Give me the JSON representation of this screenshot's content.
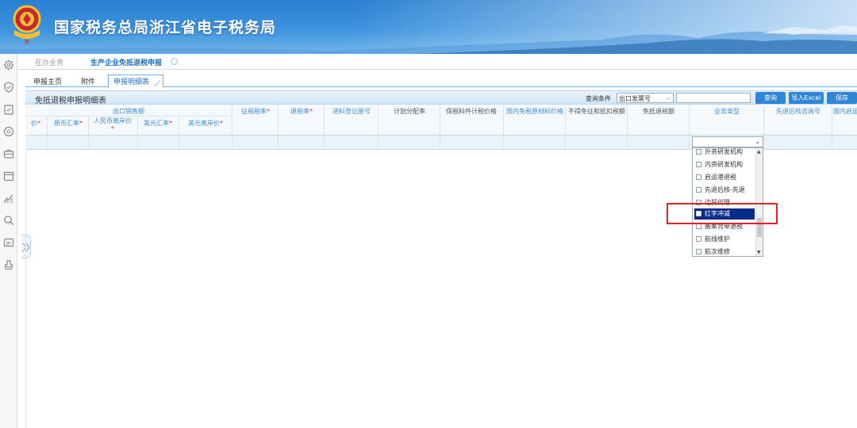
{
  "header": {
    "title": "国家税务总局浙江省电子税务局"
  },
  "top_tabs": [
    {
      "label": "在办业务"
    },
    {
      "label": "生产企业免抵退税申报"
    }
  ],
  "sub_tabs": [
    {
      "label": "申报主页"
    },
    {
      "label": "附件"
    },
    {
      "label": "申报明细表"
    }
  ],
  "panel": {
    "title": "免抵退税申报明细表",
    "query_label": "查询条件",
    "query_select": "出口发票号",
    "query_input": "",
    "buttons": {
      "query": "查询",
      "import": "导入Excel",
      "save": "保存"
    }
  },
  "columns": {
    "group": "出口销售额",
    "price": "价",
    "orig_rate": "原币汇率",
    "rmb_price": "人民币离岸价",
    "usd_rate": "美元汇率",
    "usd_price": "美元离岸价",
    "tax_rate": "征税税率",
    "refund_rate": "退税率",
    "material_no": "进料登记册号",
    "alloc_rate": "计划分配率",
    "bonded_price": "保税料件计税价格",
    "domestic_material": "国内免税原材料价格",
    "no_credit": "不得免征和抵扣税额",
    "exempt_refund": "免抵退税额",
    "biz_type": "业务类型",
    "first_refund": "先退后核咨询号",
    "domestic_start": "国内启运",
    "required_mark": "*"
  },
  "dropdown": {
    "value": "",
    "items": [
      {
        "label": "外资研发机构"
      },
      {
        "label": "内资研发机构"
      },
      {
        "label": "启运港退税"
      },
      {
        "label": "先退后核-先退"
      },
      {
        "label": "边贸代理"
      },
      {
        "label": "红字冲减"
      },
      {
        "label": "备案背单退税"
      },
      {
        "label": "航线维护"
      },
      {
        "label": "航次维修"
      }
    ]
  },
  "colors": {
    "header_blue": "#2a7fd0",
    "accent": "#3d8fd6",
    "highlight_red": "#e32222",
    "selected_item": "#0a2b8a"
  }
}
